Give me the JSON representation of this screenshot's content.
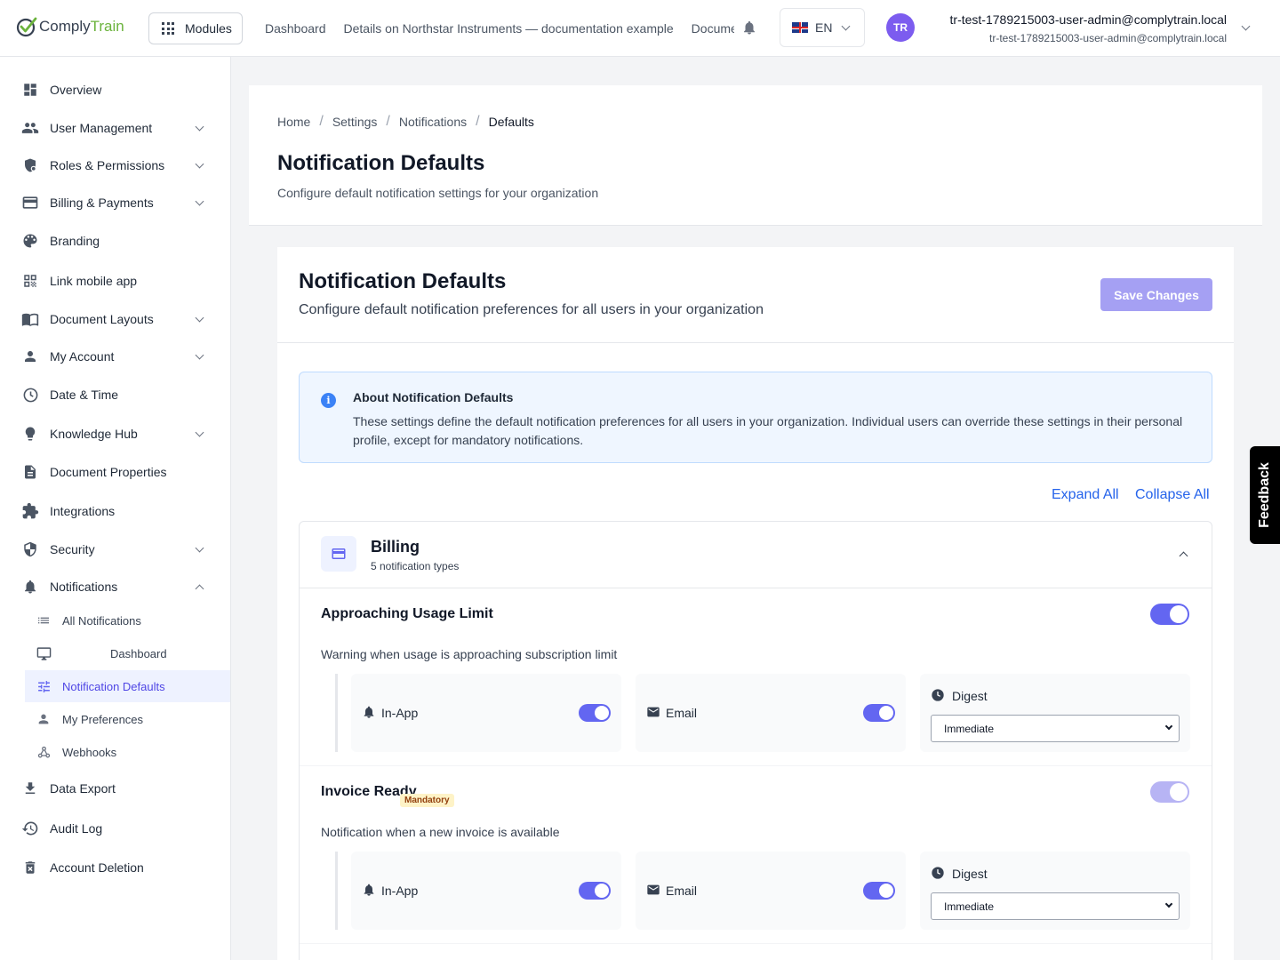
{
  "app": {
    "brand_a": "Comply",
    "brand_b": "Train"
  },
  "topbar": {
    "modules_label": "Modules",
    "nav": [
      "Dashboard",
      "Details on Northstar Instruments — documentation example",
      "Documents"
    ],
    "language": "EN",
    "avatar_initials": "TR",
    "user_name": "tr-test-1789215003-user-admin@complytrain.local",
    "user_email": "tr-test-1789215003-user-admin@complytrain.local"
  },
  "sidebar": {
    "items": [
      {
        "label": "Overview",
        "icon": "dashboard-icon"
      },
      {
        "label": "User Management",
        "icon": "users-icon"
      },
      {
        "label": "Roles & Permissions",
        "icon": "shield-user-icon"
      },
      {
        "label": "Billing & Payments",
        "icon": "credit-card-icon"
      },
      {
        "label": "Branding",
        "icon": "palette-icon"
      },
      {
        "label": "Link mobile app",
        "icon": "qr-code-icon"
      },
      {
        "label": "Document Layouts",
        "icon": "book-icon"
      },
      {
        "label": "My Account",
        "icon": "person-icon"
      },
      {
        "label": "Date & Time",
        "icon": "clock-icon"
      },
      {
        "label": "Knowledge Hub",
        "icon": "lightbulb-icon"
      },
      {
        "label": "Document Properties",
        "icon": "document-icon"
      },
      {
        "label": "Integrations",
        "icon": "puzzle-icon"
      },
      {
        "label": "Security",
        "icon": "shield-icon"
      },
      {
        "label": "Notifications",
        "icon": "bell-icon"
      },
      {
        "label": "Data Export",
        "icon": "download-icon"
      },
      {
        "label": "Audit Log",
        "icon": "history-icon"
      },
      {
        "label": "Account Deletion",
        "icon": "trash-icon"
      }
    ],
    "sub_items": [
      {
        "label": "All Notifications",
        "icon": "list-icon"
      },
      {
        "label": "Dashboard",
        "icon": "monitor-icon"
      },
      {
        "label": "Notification Defaults",
        "icon": "sliders-icon"
      },
      {
        "label": "My Preferences",
        "icon": "person-icon"
      },
      {
        "label": "Webhooks",
        "icon": "webhook-icon"
      }
    ]
  },
  "header": {
    "breadcrumb": [
      "Home",
      "Settings",
      "Notifications",
      "Defaults"
    ],
    "title": "Notification Defaults",
    "subtitle": "Configure default notification settings for your organization"
  },
  "panel": {
    "title": "Notification Defaults",
    "subtitle": "Configure default notification preferences for all users in your organization",
    "save_label": "Save Changes",
    "info_title": "About Notification Defaults",
    "info_text": "These settings define the default notification preferences for all users in your organization. Individual users can override these settings in their personal profile, except for mandatory notifications.",
    "expand_all": "Expand All",
    "collapse_all": "Collapse All"
  },
  "category": {
    "title": "Billing",
    "count": "5 notification types",
    "notifications": [
      {
        "title": "Approaching Usage Limit",
        "badge": "",
        "description": "Warning when usage is approaching subscription limit",
        "enabled": true,
        "in_app_label": "In-App",
        "email_label": "Email",
        "digest_label": "Digest",
        "digest_value": "Immediate"
      },
      {
        "title": "Invoice Ready",
        "badge": "Mandatory",
        "description": "Notification when a new invoice is available",
        "enabled": true,
        "in_app_label": "In-App",
        "email_label": "Email",
        "digest_label": "Digest",
        "digest_value": "Immediate"
      }
    ]
  },
  "feedback_label": "Feedback",
  "colors": {
    "accent": "#6366f1",
    "brand_green": "#6bb33c",
    "link": "#2563eb"
  }
}
